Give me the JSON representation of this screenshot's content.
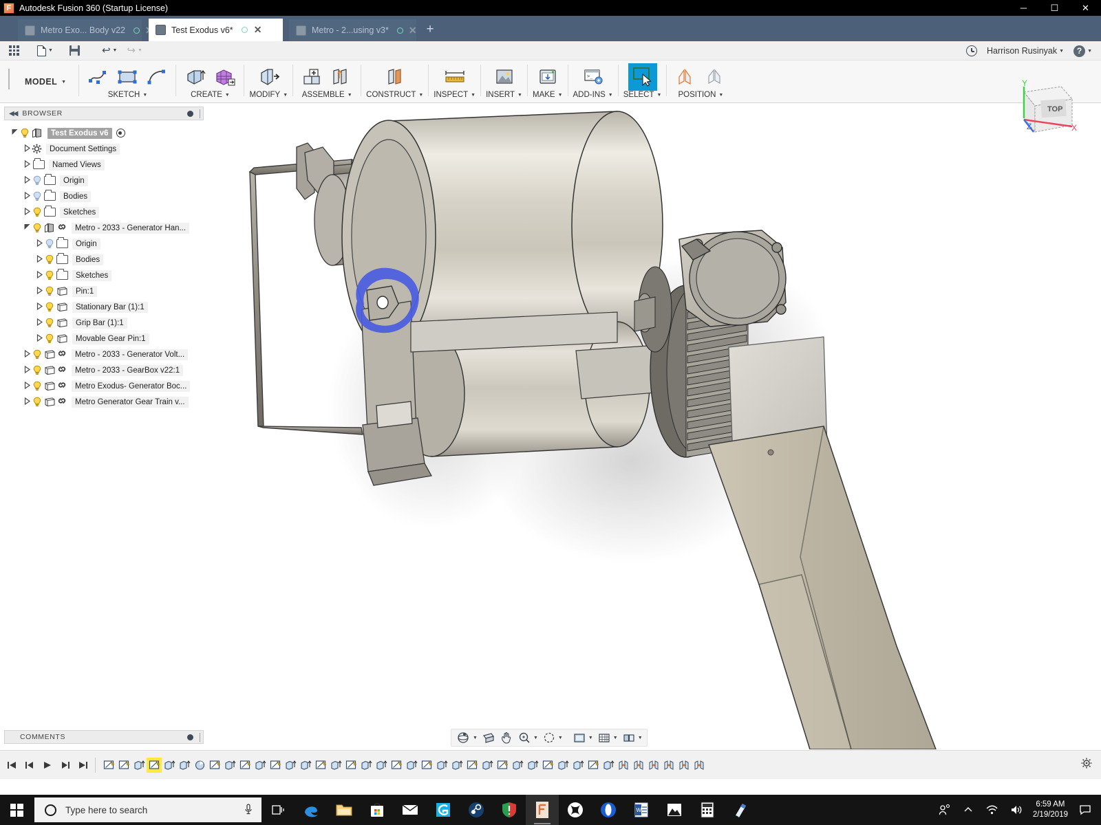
{
  "window": {
    "title": "Autodesk Fusion 360 (Startup License)",
    "app_icon": "fusion-icon",
    "minimize": "─",
    "maximize": "☐",
    "close": "✕"
  },
  "tabs": [
    {
      "label": "Metro Exo... Body v22",
      "active": false,
      "close": "✕"
    },
    {
      "label": "Test Exodus v6*",
      "active": true,
      "close": "✕"
    },
    {
      "label": "Metro - 2...using v3*",
      "active": false,
      "close": "✕"
    }
  ],
  "new_tab_label": "+",
  "quick_access": {
    "show_data_panel": "grid-icon",
    "file": "file-icon",
    "save": "save-icon",
    "undo": "undo-icon",
    "redo": "redo-icon",
    "job_status": "clock-icon",
    "user_name": "Harrison Rusinyak",
    "help": "?"
  },
  "ribbon": {
    "workspace_label": "MODEL",
    "groups": [
      {
        "label": "SKETCH",
        "tools": [
          "sketch-spline-icon",
          "sketch-rectangle-icon",
          "sketch-arc-icon"
        ]
      },
      {
        "label": "CREATE",
        "tools": [
          "extrude-icon",
          "mesh-create-icon"
        ]
      },
      {
        "label": "MODIFY",
        "tools": [
          "press-pull-icon"
        ]
      },
      {
        "label": "ASSEMBLE",
        "tools": [
          "new-component-icon",
          "joint-icon"
        ]
      },
      {
        "label": "CONSTRUCT",
        "tools": [
          "offset-plane-icon"
        ]
      },
      {
        "label": "INSPECT",
        "tools": [
          "measure-icon"
        ]
      },
      {
        "label": "INSERT",
        "tools": [
          "insert-image-icon"
        ]
      },
      {
        "label": "MAKE",
        "tools": [
          "3d-print-icon"
        ]
      },
      {
        "label": "ADD-INS",
        "tools": [
          "scripts-addins-icon"
        ]
      },
      {
        "label": "SELECT",
        "tools": [
          "select-icon"
        ],
        "selected": true
      },
      {
        "label": "POSITION",
        "tools": [
          "align-icon",
          "move-copy-icon"
        ]
      }
    ]
  },
  "browser": {
    "header": "BROWSER",
    "nodes": [
      {
        "label": "Test Exodus v6",
        "indent": 0,
        "state": "expanded",
        "icons": [
          "bulb-on",
          "component"
        ],
        "root": true,
        "radio": true
      },
      {
        "label": "Document Settings",
        "indent": 1,
        "state": "collapsed",
        "icons": [
          "gear"
        ]
      },
      {
        "label": "Named Views",
        "indent": 1,
        "state": "collapsed",
        "icons": [
          "folder"
        ]
      },
      {
        "label": "Origin",
        "indent": 1,
        "state": "collapsed",
        "icons": [
          "bulb-off",
          "folder"
        ]
      },
      {
        "label": "Bodies",
        "indent": 1,
        "state": "collapsed",
        "icons": [
          "bulb-off",
          "folder"
        ]
      },
      {
        "label": "Sketches",
        "indent": 1,
        "state": "collapsed",
        "icons": [
          "bulb-on",
          "folder"
        ]
      },
      {
        "label": "Metro - 2033 - Generator Han...",
        "indent": 1,
        "state": "expanded",
        "icons": [
          "bulb-on",
          "component",
          "link"
        ]
      },
      {
        "label": "Origin",
        "indent": 2,
        "state": "collapsed",
        "icons": [
          "bulb-off",
          "folder"
        ]
      },
      {
        "label": "Bodies",
        "indent": 2,
        "state": "collapsed",
        "icons": [
          "bulb-on",
          "folder"
        ]
      },
      {
        "label": "Sketches",
        "indent": 2,
        "state": "collapsed",
        "icons": [
          "bulb-on",
          "folder"
        ]
      },
      {
        "label": "Pin:1",
        "indent": 2,
        "state": "collapsed",
        "icons": [
          "bulb-on",
          "body"
        ]
      },
      {
        "label": "Stationary Bar (1):1",
        "indent": 2,
        "state": "collapsed",
        "icons": [
          "bulb-on",
          "body"
        ]
      },
      {
        "label": "Grip Bar (1):1",
        "indent": 2,
        "state": "collapsed",
        "icons": [
          "bulb-on",
          "body"
        ]
      },
      {
        "label": "Movable Gear Pin:1",
        "indent": 2,
        "state": "collapsed",
        "icons": [
          "bulb-on",
          "body"
        ]
      },
      {
        "label": "Metro - 2033 - Generator Volt...",
        "indent": 1,
        "state": "collapsed",
        "icons": [
          "bulb-on",
          "body",
          "link"
        ]
      },
      {
        "label": "Metro - 2033 - GearBox v22:1",
        "indent": 1,
        "state": "collapsed",
        "icons": [
          "bulb-on",
          "body",
          "link"
        ]
      },
      {
        "label": "Metro Exodus- Generator Boc...",
        "indent": 1,
        "state": "collapsed",
        "icons": [
          "bulb-on",
          "body",
          "link"
        ]
      },
      {
        "label": "Metro Generator Gear Train v...",
        "indent": 1,
        "state": "collapsed",
        "icons": [
          "bulb-on",
          "body",
          "link"
        ]
      }
    ]
  },
  "comments": {
    "header": "COMMENTS"
  },
  "viewcube": {
    "face_label": "TOP",
    "axis_x": "X",
    "axis_y": "Y",
    "axis_z": "Z",
    "color_x": "#e8455a",
    "color_y": "#3dd13d",
    "color_z": "#3b6fe0"
  },
  "canvas": {
    "annotation_color": "#4a5ce0",
    "annotation_name": "blue-circle-markup",
    "background": "#ffffff"
  },
  "navbar": {
    "items": [
      "orbit-icon",
      "look-at-icon",
      "pan-icon",
      "zoom-icon",
      "fit-icon",
      "display-settings-icon",
      "grid-snap-icon",
      "viewports-icon"
    ]
  },
  "timeline": {
    "controls": [
      "go-to-beginning",
      "step-back",
      "play",
      "step-forward",
      "go-to-end"
    ],
    "feature_count": 40,
    "highlighted_index": 3,
    "settings": "gear-icon"
  },
  "taskbar": {
    "start": "windows-logo",
    "search_placeholder": "Type here to search",
    "mic": "microphone-icon",
    "task_view": "task-view-icon",
    "apps": [
      "edge-icon",
      "file-explorer-icon",
      "microsoft-store-icon",
      "mail-icon",
      "cura-icon",
      "steam-icon",
      "antivirus-icon",
      "fusion360-icon",
      "xbox-icon",
      "opera-icon",
      "word-icon",
      "photos-icon",
      "calculator-icon",
      "onenote-icon"
    ],
    "tray": [
      "people-icon",
      "show-hidden-icon",
      "network-icon",
      "volume-icon"
    ],
    "time": "6:59 AM",
    "date": "2/19/2019",
    "action_center": "action-center-icon"
  }
}
